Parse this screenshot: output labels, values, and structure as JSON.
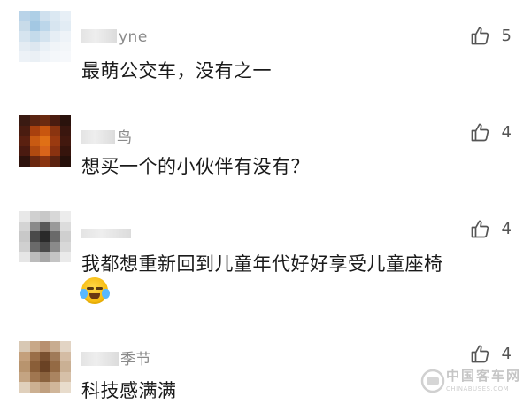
{
  "comments": [
    {
      "username": "yne",
      "text": "最萌公交车，没有之一",
      "likes": "5"
    },
    {
      "username": "鸟",
      "text": "想买一个的小伙伴有没有？",
      "likes": "4"
    },
    {
      "username": "",
      "text": "我都想重新回到儿童年代好好享受儿童座椅",
      "likes": "4",
      "emoji": "crying-laughing-emoji"
    },
    {
      "username": "季节",
      "text": "科技感满满",
      "likes": "4"
    }
  ],
  "watermark": {
    "brand": "中国客车网",
    "site": "CHINABUSES.COM"
  },
  "colors": {
    "text": "#1a1a1a",
    "username": "#8a8a8a",
    "icon": "#555555"
  }
}
